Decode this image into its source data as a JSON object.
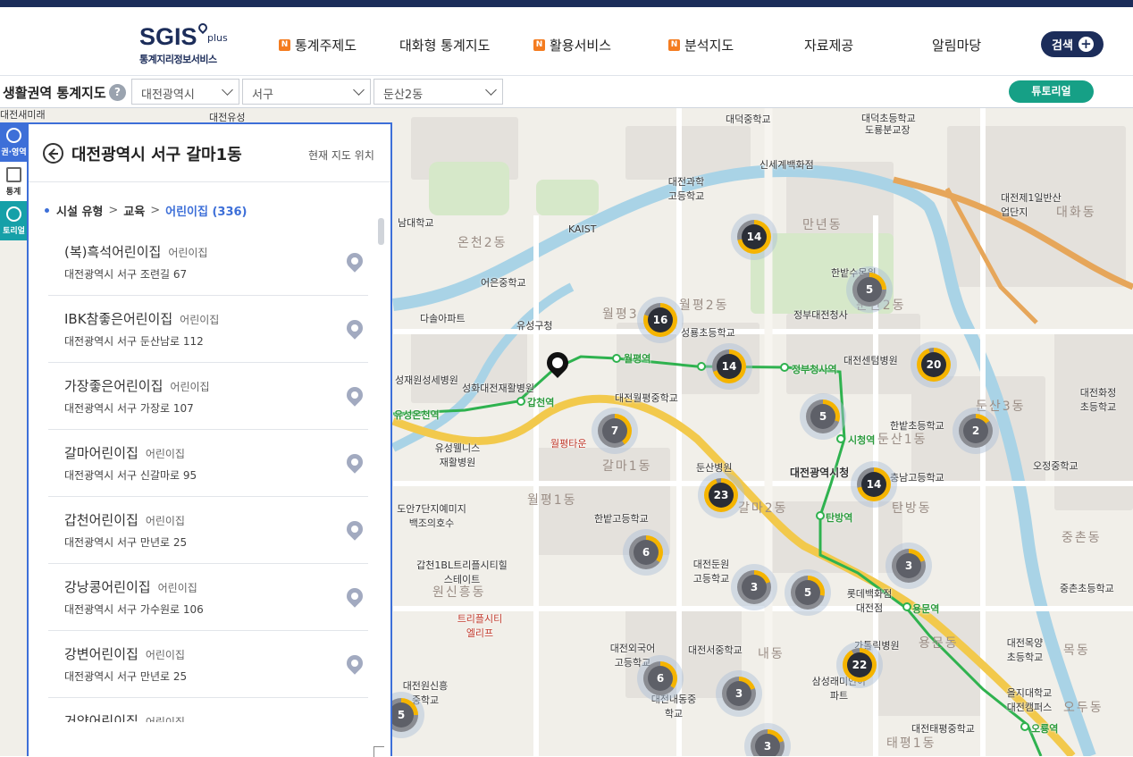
{
  "header": {
    "logo_main": "SGIS",
    "logo_plus": "plus",
    "logo_sub": "통계지리정보서비스",
    "nav": [
      {
        "label": "통계주제도",
        "badge": "N"
      },
      {
        "label": "대화형 통계지도",
        "badge": ""
      },
      {
        "label": "활용서비스",
        "badge": "N"
      },
      {
        "label": "분석지도",
        "badge": "N"
      },
      {
        "label": "자료제공",
        "badge": ""
      },
      {
        "label": "알림마당",
        "badge": ""
      }
    ],
    "search_label": "검색"
  },
  "toolbar": {
    "title": "생활권역 통계지도",
    "help": "?",
    "sido": "대전광역시",
    "sigungu": "서구",
    "dong": "둔산2동",
    "tutorial": "튜토리얼"
  },
  "sidetabs": [
    {
      "label": "권·영역",
      "color": "#3d6fd8"
    },
    {
      "label": "통계",
      "color": "#ffffff"
    },
    {
      "label": "토리얼",
      "color": "#16a0a8"
    }
  ],
  "panel": {
    "title": "대전광역시 서구 갈마1동",
    "current_location": "현재 지도 위치",
    "crumb": {
      "level1": "시설 유형",
      "level2": "교육",
      "level3": "어린이집 (336)"
    },
    "items": [
      {
        "name": "(복)흑석어린이집",
        "type": "어린이집",
        "addr": "대전광역시 서구 조련길 67"
      },
      {
        "name": "IBK참좋은어린이집",
        "type": "어린이집",
        "addr": "대전광역시 서구 둔산남로 112"
      },
      {
        "name": "가장좋은어린이집",
        "type": "어린이집",
        "addr": "대전광역시 서구 가장로 107"
      },
      {
        "name": "갈마어린이집",
        "type": "어린이집",
        "addr": "대전광역시 서구 신갈마로 95"
      },
      {
        "name": "갑천어린이집",
        "type": "어린이집",
        "addr": "대전광역시 서구 만년로 25"
      },
      {
        "name": "강낭콩어린이집",
        "type": "어린이집",
        "addr": "대전광역시 서구 가수원로 106"
      },
      {
        "name": "강변어린이집",
        "type": "어린이집",
        "addr": "대전광역시 서구 만년로 25"
      },
      {
        "name": "거양어린이집",
        "type": "어린이집",
        "addr": ""
      }
    ]
  },
  "map": {
    "districts": [
      "온천2동",
      "만년동",
      "월평3",
      "월평2동",
      "둔산2동",
      "둔산1동",
      "둔산3동",
      "갈마1동",
      "월평1동",
      "갈마2동",
      "탄방동",
      "원신흥동",
      "용문동",
      "중촌동",
      "목동",
      "오두동",
      "태평1동",
      "대화동",
      "내동"
    ],
    "labels": [
      "대전새미래",
      "대전유성",
      "대덕중학교",
      "대덕초등학교",
      "도룡분교장",
      "신세계백화점",
      "대전과학고등학교",
      "대전제1일반산업단지",
      "KAIST",
      "남대학교",
      "어은중학교",
      "한밭수목원",
      "정부대전청사",
      "다솔아파트",
      "유성구청",
      "성룡초등학교",
      "대전센텀병원",
      "성재원성세병원",
      "성화대전재활병원",
      "대전월평중학교",
      "대전화정초등학교",
      "유성웰니스재활병원",
      "월평타운",
      "둔산병원",
      "대전광역시청",
      "한밭초등학교",
      "충남고등학교",
      "오정중학교",
      "도안7단지예미지백조의호수",
      "한밭고등학교",
      "대전둔원고등학교",
      "갑천1BL트리플시티힐스테이트",
      "트리플시티엘리프",
      "롯데백화점대전점",
      "중촌초등학교",
      "대전목양초등학교",
      "대전외국어고등학교",
      "대전서중학교",
      "가톨릭병원",
      "삼성래미안아파트",
      "대전원신흥중학교",
      "대전내동중학교",
      "을지대학교대전캠퍼스",
      "대전태평중학교"
    ],
    "stations": [
      "유성온천역",
      "갑천역",
      "월평역",
      "정부청사역",
      "시청역",
      "탄방역",
      "용문역",
      "오룡역"
    ],
    "clusters": [
      {
        "count": 14,
        "ratio": 0.72
      },
      {
        "count": 16,
        "ratio": 0.8
      },
      {
        "count": 14,
        "ratio": 0.7
      },
      {
        "count": 5,
        "ratio": 0.25
      },
      {
        "count": 20,
        "ratio": 0.95
      },
      {
        "count": 5,
        "ratio": 0.3
      },
      {
        "count": 2,
        "ratio": 0.15
      },
      {
        "count": 7,
        "ratio": 0.4
      },
      {
        "count": 14,
        "ratio": 0.72
      },
      {
        "count": 23,
        "ratio": 0.95
      },
      {
        "count": 6,
        "ratio": 0.35
      },
      {
        "count": 3,
        "ratio": 0.2
      },
      {
        "count": 5,
        "ratio": 0.28
      },
      {
        "count": 3,
        "ratio": 0.2
      },
      {
        "count": 22,
        "ratio": 0.92
      },
      {
        "count": 6,
        "ratio": 0.35
      },
      {
        "count": 3,
        "ratio": 0.2
      },
      {
        "count": 3,
        "ratio": 0.2
      },
      {
        "count": 5,
        "ratio": 0.25
      }
    ]
  }
}
